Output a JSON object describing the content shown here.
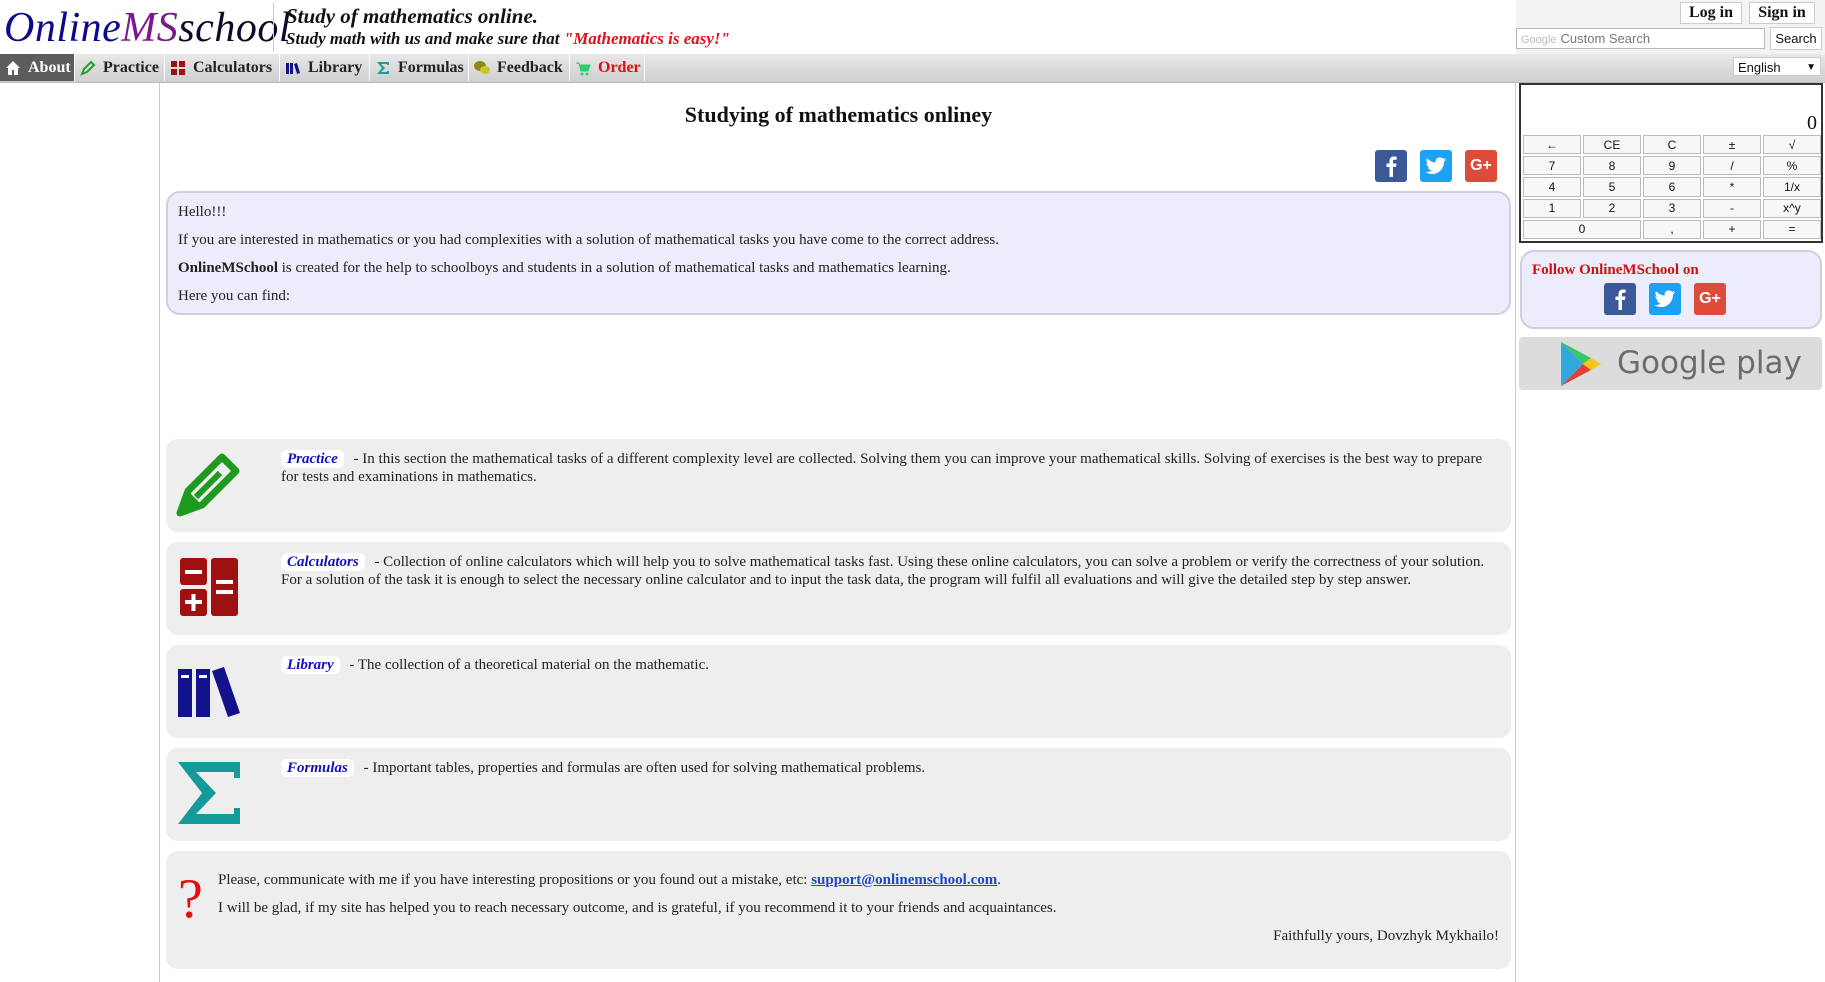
{
  "header": {
    "logo": {
      "part1": "Online",
      "part2": "MS",
      "part3": "chool",
      "s": "s"
    },
    "tagline_line1": "Study of mathematics online.",
    "tagline_line2": "Study math with us and make sure that ",
    "tagline_quote": "\"Mathematics is easy!\"",
    "login_label": "Log in",
    "signin_label": "Sign in",
    "search_brand": "Google",
    "search_placeholder": "Custom Search",
    "search_button": "Search"
  },
  "nav": {
    "items": [
      {
        "label": "About",
        "icon": "home-icon"
      },
      {
        "label": "Practice",
        "icon": "pencil-icon"
      },
      {
        "label": "Calculators",
        "icon": "calculator-icon"
      },
      {
        "label": "Library",
        "icon": "books-icon"
      },
      {
        "label": "Formulas",
        "icon": "sigma-icon"
      },
      {
        "label": "Feedback",
        "icon": "chat-icon"
      },
      {
        "label": "Order",
        "icon": "cart-icon"
      }
    ],
    "language": "English"
  },
  "main": {
    "title": "Studying of mathematics onliney",
    "intro": {
      "greeting": "Hello!!!",
      "line2": "If you are interested in mathematics or you had complexities with a solution of mathematical tasks you have come to the correct address.",
      "brand": "OnlineMSchool",
      "line3_rest": " is created for the help to schoolboys and students in a solution of mathematical tasks and mathematics learning.",
      "line4": "Here you can find:"
    },
    "sections": [
      {
        "link": "Practice",
        "text": " - In this section the mathematical tasks of a different complexity level are collected. Solving them you can improve your mathematical skills. Solving of exercises is the best way to prepare for tests and examinations in mathematics."
      },
      {
        "link": "Calculators",
        "text": " - Collection of online calculators which will help you to solve mathematical tasks fast. Using these online calculators, you can solve a problem or verify the correctness of your solution. For a solution of the task it is enough to select the necessary online calculator and to input the task data, the program will fulfil all evaluations and will give the detailed step by step answer."
      },
      {
        "link": "Library",
        "text": " - The collection of a theoretical material on the mathematic."
      },
      {
        "link": "Formulas",
        "text": " - Important tables, properties and formulas are often used for solving mathematical problems."
      }
    ],
    "contact": {
      "line1": "Please, communicate with me if you have interesting propositions or you found out a mistake, etc: ",
      "email": "support@onlinemschool.com",
      "line1_end": ".",
      "line2": "I will be glad, if my site has helped you to reach necessary outcome, and is grateful, if you recommend it to your friends and acquaintances.",
      "signature": "Faithfully yours, Dovzhyk Mykhailo!"
    }
  },
  "calculator": {
    "display": "0",
    "keys": [
      "←",
      "CE",
      "C",
      "±",
      "√",
      "7",
      "8",
      "9",
      "/",
      "%",
      "4",
      "5",
      "6",
      "*",
      "1/x",
      "1",
      "2",
      "3",
      "-",
      "x^y",
      "0",
      ",",
      "+",
      "="
    ]
  },
  "sidebar": {
    "follow_title": "Follow OnlineMSchool on",
    "google_play": "Google play"
  },
  "colors": {
    "facebook": "#3b5998",
    "twitter": "#1da1f2",
    "googleplus": "#dd4b39",
    "accent_red": "#e01010",
    "link_blue": "#1010c0"
  }
}
